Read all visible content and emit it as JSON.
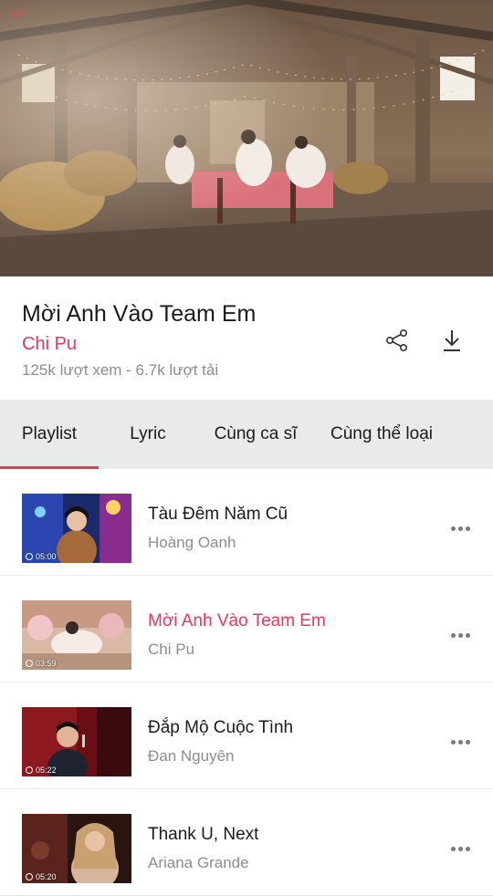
{
  "video": {
    "watermark": "csn"
  },
  "now_playing": {
    "title": "Mời Anh Vào Team Em",
    "artist": "Chi Pu",
    "stats": "125k lượt xem - 6.7k lượt tải",
    "share_icon": "share-icon",
    "download_icon": "download-icon"
  },
  "tabs": [
    {
      "label": "Playlist",
      "active": true
    },
    {
      "label": "Lyric",
      "active": false
    },
    {
      "label": "Cùng ca sĩ",
      "active": false
    },
    {
      "label": "Cùng thể loại",
      "active": false
    }
  ],
  "playlist": [
    {
      "title": "Tàu Đêm Năm Cũ",
      "artist": "Hoàng Oanh",
      "duration": "05:00",
      "active": false
    },
    {
      "title": "Mời Anh Vào Team Em",
      "artist": "Chi Pu",
      "duration": "03:59",
      "active": true
    },
    {
      "title": "Đắp Mộ Cuộc Tình",
      "artist": "Đan Nguyên",
      "duration": "05:22",
      "active": false
    },
    {
      "title": "Thank U, Next",
      "artist": "Ariana Grande",
      "duration": "05:20",
      "active": false
    }
  ],
  "colors": {
    "accent": "#e8385d",
    "tab_bar": "#e9eaea",
    "text": "#1a1a1a",
    "muted": "#8d8d8d"
  }
}
